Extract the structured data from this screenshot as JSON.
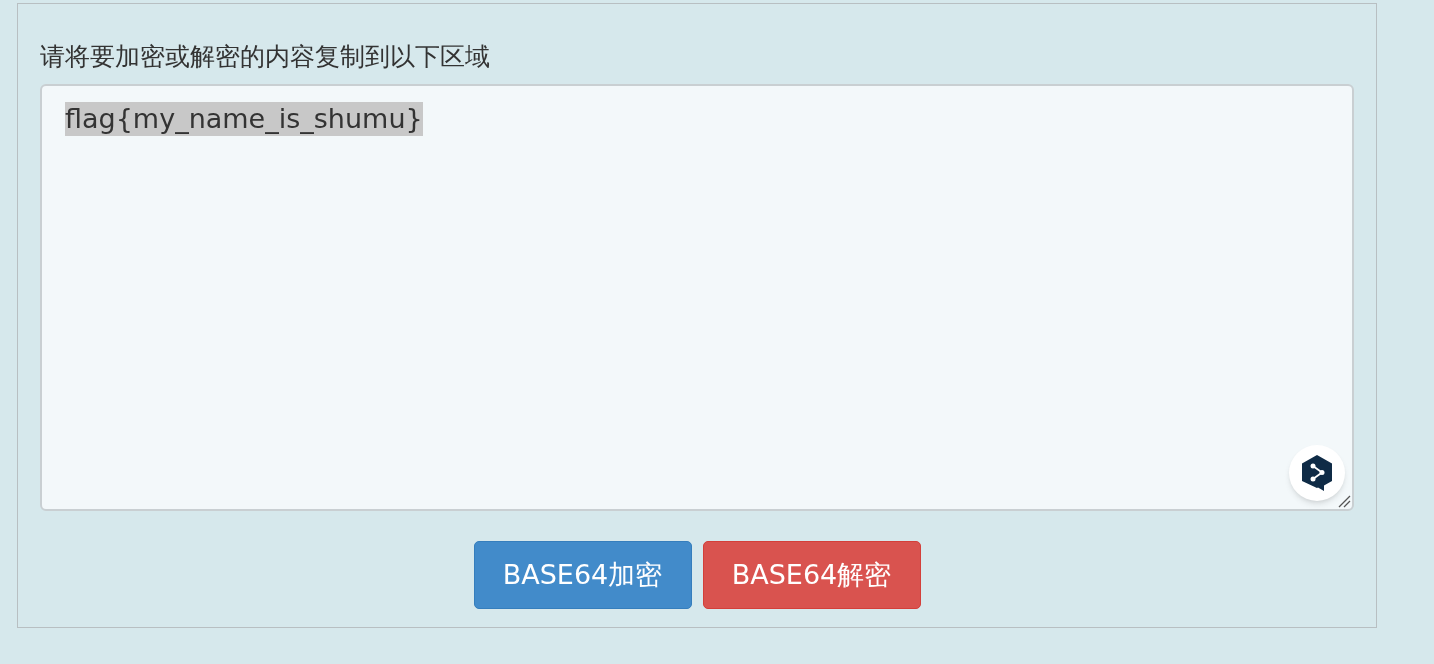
{
  "label": "请将要加密或解密的内容复制到以下区域",
  "text_area": {
    "value": "flag{my_name_is_shumu}",
    "selected": true
  },
  "buttons": [
    {
      "label": "BASE64加密",
      "kind": "primary"
    },
    {
      "label": "BASE64解密",
      "kind": "danger"
    }
  ]
}
